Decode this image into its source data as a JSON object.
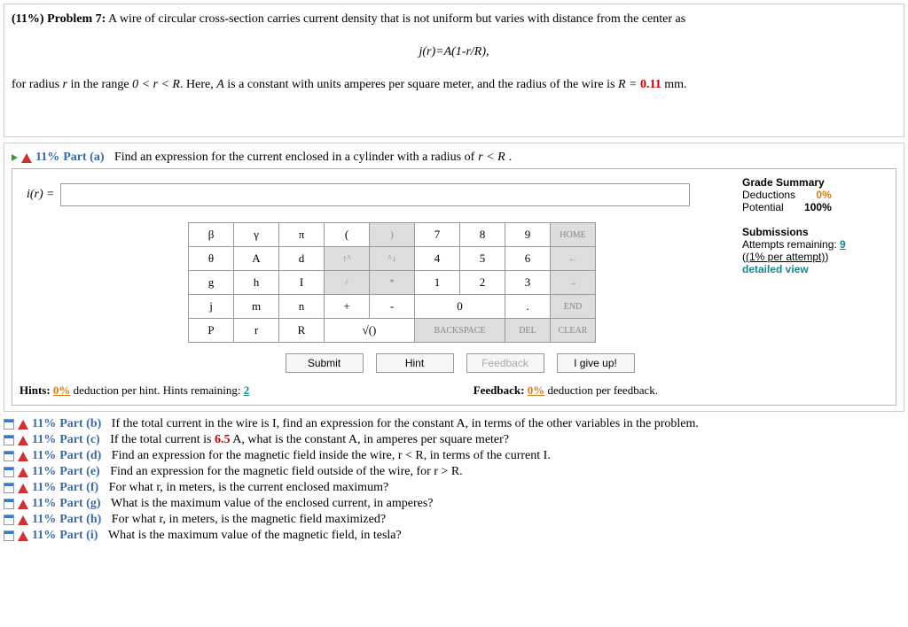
{
  "problem": {
    "header_pct": "(11%)",
    "header_label": "Problem 7:",
    "text1": "A wire of circular cross-section carries current density that is not uniform but varies with distance from the center as",
    "equation": "j(r)=A(1-r/R),",
    "text2a": "for radius ",
    "text2b": " in the range ",
    "text2c": ". Here, ",
    "text2d": " is a constant with units amperes per square meter, and the radius of the wire is ",
    "r_var": "r",
    "range": "0 < r < R",
    "A_var": "A",
    "R_eq": "R = ",
    "R_val": "0.11",
    "mm": " mm."
  },
  "partA": {
    "pct": "11%",
    "label": "Part (a)",
    "prompt": "Find an expression for the current enclosed in a cylinder with a radius of ",
    "rlR": "r < R",
    "lhs": "i(r) = ",
    "value": ""
  },
  "grade": {
    "title": "Grade Summary",
    "ded_l": "Deductions",
    "ded_v": "0%",
    "pot_l": "Potential",
    "pot_v": "100%",
    "sub_title": "Submissions",
    "att_label": "Attempts remaining: ",
    "att_val": "9",
    "pct_note": "(1% per attempt)",
    "detail": "detailed view"
  },
  "keypad": {
    "r1": [
      "β",
      "γ",
      "π",
      "(",
      ")",
      "7",
      "8",
      "9",
      "HOME"
    ],
    "r2": [
      "θ",
      "A",
      "d",
      "↑^",
      "^↓",
      "4",
      "5",
      "6",
      "←"
    ],
    "r3": [
      "g",
      "h",
      "I",
      "/",
      "*",
      "1",
      "2",
      "3",
      "→"
    ],
    "r4": [
      "j",
      "m",
      "n",
      "+",
      "-",
      "0",
      ".",
      "END"
    ],
    "r5": [
      "P",
      "r",
      "R",
      "√()",
      "BACKSPACE",
      "DEL",
      "CLEAR"
    ]
  },
  "buttons": {
    "submit": "Submit",
    "hint": "Hint",
    "feedback": "Feedback",
    "giveup": "I give up!"
  },
  "hints": {
    "l1": "Hints: ",
    "l2": " deduction per hint. Hints remaining: ",
    "pct": "0%",
    "rem": "2",
    "f1": "Feedback: ",
    "f2": " deduction per feedback.",
    "fpct": "0%"
  },
  "parts": [
    {
      "pct": "11%",
      "label": "Part (b)",
      "text": "If the total current in the wire is I, find an expression for the constant A, in terms of the other variables in the problem."
    },
    {
      "pct": "11%",
      "label": "Part (c)",
      "text": "If the total current is 6.5 A, what is the constant A, in amperes per square meter?",
      "hl": "6.5"
    },
    {
      "pct": "11%",
      "label": "Part (d)",
      "text": "Find an expression for the magnetic field inside the wire, r < R, in terms of the current I."
    },
    {
      "pct": "11%",
      "label": "Part (e)",
      "text": "Find an expression for the magnetic field outside of the wire, for r > R."
    },
    {
      "pct": "11%",
      "label": "Part (f)",
      "text": "For what r, in meters, is the current enclosed maximum?"
    },
    {
      "pct": "11%",
      "label": "Part (g)",
      "text": "What is the maximum value of the enclosed current, in amperes?"
    },
    {
      "pct": "11%",
      "label": "Part (h)",
      "text": "For what r, in meters, is the magnetic field maximized?"
    },
    {
      "pct": "11%",
      "label": "Part (i)",
      "text": "What is the maximum value of the magnetic field, in tesla?"
    }
  ]
}
